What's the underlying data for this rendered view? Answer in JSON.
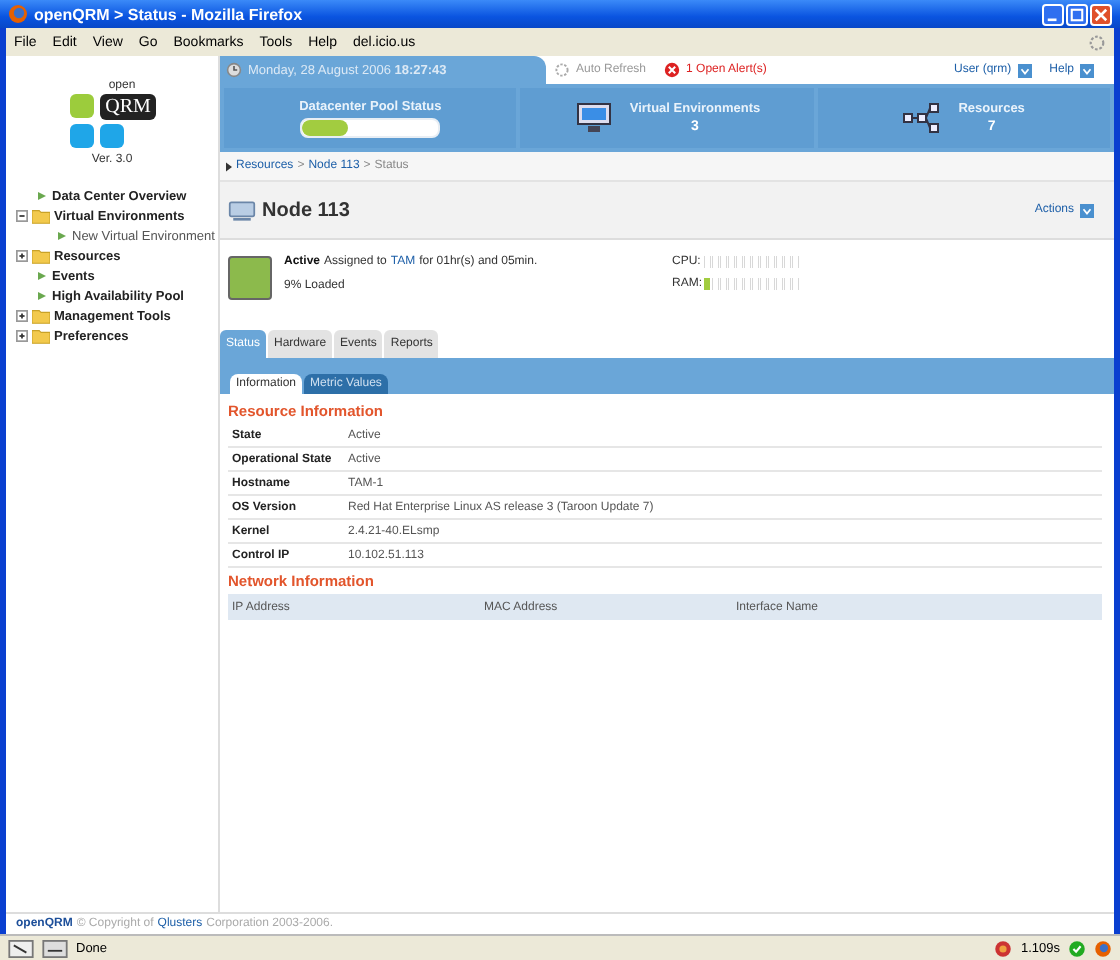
{
  "window": {
    "title": "openQRM > Status - Mozilla Firefox"
  },
  "menu": [
    "File",
    "Edit",
    "View",
    "Go",
    "Bookmarks",
    "Tools",
    "Help",
    "del.icio.us"
  ],
  "logo": {
    "top": "open",
    "main": "QRM",
    "version": "Ver. 3.0"
  },
  "sidebar": {
    "items": [
      {
        "label": "Data Center Overview",
        "kind": "leaf"
      },
      {
        "label": "Virtual Environments",
        "kind": "folder",
        "expanded": true,
        "children": [
          {
            "label": "New Virtual Environment",
            "kind": "leaf"
          }
        ]
      },
      {
        "label": "Resources",
        "kind": "folder",
        "expanded": false
      },
      {
        "label": "Events",
        "kind": "leaf"
      },
      {
        "label": "High Availability Pool",
        "kind": "leaf"
      },
      {
        "label": "Management Tools",
        "kind": "folder",
        "expanded": false
      },
      {
        "label": "Preferences",
        "kind": "folder",
        "expanded": false
      }
    ]
  },
  "topbar": {
    "date": "Monday, 28 August 2006 **18:27:43**",
    "auto_refresh": "Auto Refresh",
    "alert": "1 Open Alert(s)",
    "user": "User (qrm)",
    "help": "Help"
  },
  "summary": [
    {
      "kind": "pool",
      "title": "Datacenter Pool Status",
      "level": 0.33
    },
    {
      "kind": "count",
      "title": "Virtual Environments",
      "value": "3"
    },
    {
      "kind": "count",
      "title": "Resources",
      "value": "7"
    }
  ],
  "breadcrumb": [
    {
      "label": "Resources",
      "link": true
    },
    {
      "separator": ">",
      "label": "Node 113",
      "link": true
    },
    {
      "separator": ">",
      "label": "Status",
      "link": false
    }
  ],
  "node": {
    "title": "Node 113",
    "actions": "Actions"
  },
  "status": {
    "state": "Active",
    "assigned": "Assigned to",
    "owner": "TAM",
    "duration": "for 01hr(s) and 05min.",
    "loaded": "9% Loaded",
    "meters": [
      {
        "label": "CPU:"
      },
      {
        "label": "RAM:",
        "level": 0.08
      }
    ]
  },
  "tabs": [
    {
      "label": "Status",
      "selected": true
    },
    {
      "label": "Hardware",
      "selected": false
    },
    {
      "label": "Events",
      "selected": false
    },
    {
      "label": "Reports",
      "selected": false
    }
  ],
  "subtabs": [
    {
      "label": "Information",
      "selected": true
    },
    {
      "label": "Metric Values",
      "selected": false
    }
  ],
  "resource_info": {
    "title": "Resource Information",
    "rows": [
      {
        "label": "State",
        "value": "Active"
      },
      {
        "label": "Operational State",
        "value": "Active"
      },
      {
        "label": "Hostname",
        "value": "TAM-1"
      },
      {
        "label": "OS Version",
        "value": "Red Hat Enterprise Linux AS release 3 (Taroon Update 7)"
      },
      {
        "label": "Kernel",
        "value": "2.4.21-40.ELsmp"
      },
      {
        "label": "Control IP",
        "value": "10.102.51.113"
      }
    ]
  },
  "network_info": {
    "title": "Network Information",
    "columns": [
      "IP Address",
      "MAC Address",
      "Interface Name"
    ]
  },
  "footer": {
    "brand": "openQRM",
    "copyright": "© Copyright of",
    "company": "Qlusters",
    "rest": "Corporation 2003-2006."
  },
  "status_bar": {
    "text": "Done",
    "timing": "1.109s"
  }
}
